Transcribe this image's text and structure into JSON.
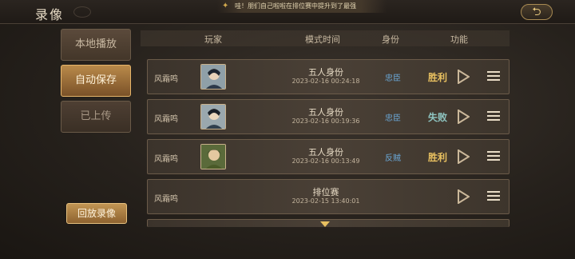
{
  "header": {
    "title": "录像",
    "marquee": "哇！朋们自己啦啦在排位赛中提升到了最强",
    "back_icon": "back-arrow-icon"
  },
  "sidebar": {
    "tabs": [
      {
        "label": "本地播放"
      },
      {
        "label": "自动保存"
      },
      {
        "label": "已上传"
      }
    ],
    "replay_button": "回放录像"
  },
  "table": {
    "columns": [
      "玩家",
      "模式时间",
      "身份",
      "功能"
    ],
    "rows": [
      {
        "player": "风霜鸣",
        "mode": "五人身份",
        "time": "2023-02-16 00:24:18",
        "role": "忠臣",
        "result": "胜利"
      },
      {
        "player": "风霜鸣",
        "mode": "五人身份",
        "time": "2023-02-16 00:19:36",
        "role": "忠臣",
        "result": "失败"
      },
      {
        "player": "风霜鸣",
        "mode": "五人身份",
        "time": "2023-02-16 00:13:49",
        "role": "反贼",
        "result": "胜利"
      },
      {
        "player": "风霜鸣",
        "mode": "排位赛",
        "time": "2023-02-15 13:40:01",
        "role": "",
        "result": ""
      }
    ]
  },
  "colors": {
    "accent": "#e8c060",
    "role_blue": "#6aa7d6"
  }
}
